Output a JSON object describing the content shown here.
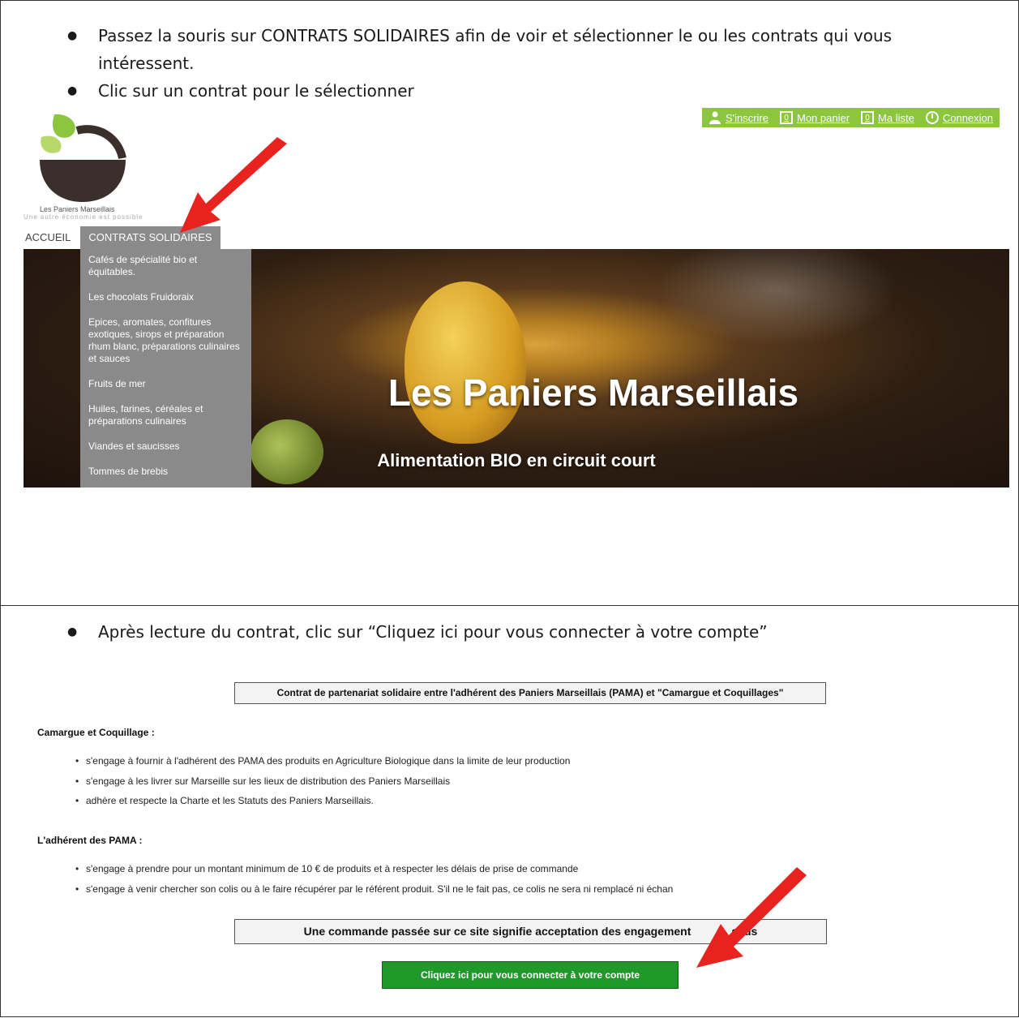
{
  "step1": {
    "bullets": [
      "Passez la souris sur CONTRATS SOLIDAIRES afin de voir et sélectionner le ou les contrats qui vous intéressent.",
      "Clic sur un contrat pour le sélectionner"
    ]
  },
  "site": {
    "topbar": {
      "signup": "S'inscrire",
      "cart_count": "0",
      "cart": "Mon panier",
      "list_count": "0",
      "list": "Ma liste",
      "login": "Connexion",
      "color": "#8cc63f"
    },
    "logo": {
      "name": "Les Paniers Marseillais",
      "tagline": "Une autre économie est possible"
    },
    "nav": {
      "home": "ACCUEIL",
      "contracts": "CONTRATS SOLIDAIRES"
    },
    "dropdown": [
      "Cafés de spécialité bio et équitables.",
      "Les chocolats Fruidoraix",
      "Epices, aromates, confitures exotiques, sirops et préparation rhum blanc, préparations culinaires et sauces",
      "Fruits de mer",
      "Huiles, farines, céréales et préparations culinaires",
      "Viandes et saucisses",
      "Tommes de brebis"
    ],
    "banner": {
      "title": "Les Paniers Marseillais",
      "subtitle": "Alimentation BIO en circuit court"
    }
  },
  "step2": {
    "bullets": [
      "Après lecture du contrat, clic sur “Cliquez ici pour vous connecter à votre compte”"
    ]
  },
  "contract": {
    "title": "Contrat de partenariat solidaire entre l'adhérent des Paniers Marseillais (PAMA) et \"Camargue et Coquillages\"",
    "producer_heading": "Camargue et Coquillage  :",
    "producer_items": [
      "s'engage à fournir à l'adhérent des PAMA des produits en Agriculture Biologique dans la limite de leur production",
      "s'engage à les livrer sur Marseille sur les lieux de distribution des Paniers Marseillais",
      "adhère et respecte la Charte et les Statuts des Paniers Marseillais."
    ],
    "member_heading": "L'adhérent des PAMA :",
    "member_items": [
      "s'engage à prendre pour un montant minimum de 10 € de produits et à respecter les délais de prise de commande",
      "s'engage à venir chercher son colis ou à le faire récupérer par le référent produit. S'il ne le fait pas, ce colis ne sera ni remplacé ni échan"
    ],
    "acceptance": "Une commande passée sur ce site signifie acceptation des engagement",
    "acceptance_tail": "ssus",
    "connect_button": "Cliquez ici pour vous connecter à votre compte",
    "button_color": "#1f9a2a"
  },
  "annotation_color": "#e8231f"
}
